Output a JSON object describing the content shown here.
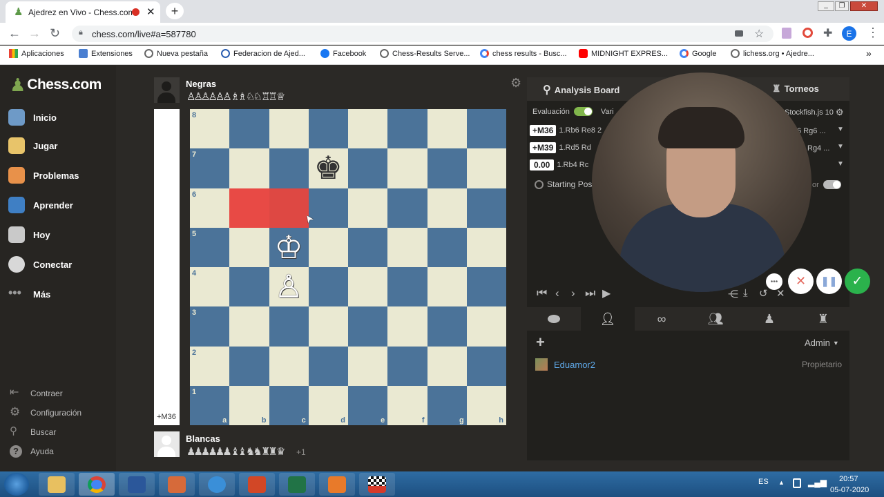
{
  "browser": {
    "tab_title": "Ajedrez en Vivo - Chess.com",
    "new_tab": "+",
    "url": "chess.com/live#a=587780",
    "profile_initial": "E",
    "bookmarks": [
      "Aplicaciones",
      "Extensiones",
      "Nueva pestaña",
      "Federacion de Ajed...",
      "Facebook",
      "Chess-Results Serve...",
      "chess results - Busc...",
      "MIDNIGHT EXPRES...",
      "Google",
      "lichess.org • Ajedre..."
    ],
    "more": "»"
  },
  "sidebar": {
    "logo": "Chess.com",
    "items": [
      {
        "label": "Inicio",
        "color": "#6e9ac7"
      },
      {
        "label": "Jugar",
        "color": "#e8c46a"
      },
      {
        "label": "Problemas",
        "color": "#e8914a"
      },
      {
        "label": "Aprender",
        "color": "#3f7fc4"
      },
      {
        "label": "Hoy",
        "color": "#c9c9c9"
      },
      {
        "label": "Conectar",
        "color": "#d8d8d8"
      },
      {
        "label": "Más",
        "color": "#9a9a9a"
      }
    ],
    "bottom": [
      "Contraer",
      "Configuración",
      "Buscar",
      "Ayuda"
    ]
  },
  "game": {
    "black_name": "Negras",
    "black_captured": "♙♙♙♙♙♙ ♗♗ ♘♘ ♖♖ ♕",
    "white_name": "Blancas",
    "white_captured": "♟♟♟♟♟♟ ♝♝ ♞♞ ♜♜ ♛",
    "white_plus": "+1",
    "eval_label": "+M36",
    "ranks": [
      "8",
      "7",
      "6",
      "5",
      "4",
      "3",
      "2",
      "1"
    ],
    "files": [
      "a",
      "b",
      "c",
      "d",
      "e",
      "f",
      "g",
      "h"
    ],
    "pieces": [
      {
        "glyph": "♚",
        "square": "d7",
        "color": "black"
      },
      {
        "glyph": "♔",
        "square": "c5",
        "color": "white"
      },
      {
        "glyph": "♙",
        "square": "c4",
        "color": "white"
      }
    ],
    "highlights": [
      "b6",
      "c6"
    ],
    "highlight_color": "#e84a45"
  },
  "panel": {
    "analysis_tab": "Analysis Board",
    "tournaments_tab": "Torneos",
    "evaluation_label": "Evaluación",
    "variations_label": "Vari",
    "engine": "Stockfish.js 10",
    "lines": [
      {
        "score": "+M36",
        "moves": "1.Rb6 Re8 2",
        "tail": "6 Rg6 ..."
      },
      {
        "score": "+M39",
        "moves": "1.Rd5 Rd",
        "tail": "Rg4 ..."
      },
      {
        "score": "0.00",
        "moves": "1.Rb4 Rc",
        "tail": ""
      }
    ],
    "starting_pos": "Starting Pos",
    "toggle_label": "or",
    "add_label": "+",
    "admin_label": "Admin",
    "member_name": "Eduamor2",
    "member_role": "Propietario"
  },
  "taskbar": {
    "lang": "ES",
    "time": "20:57",
    "date": "05-07-2020"
  }
}
